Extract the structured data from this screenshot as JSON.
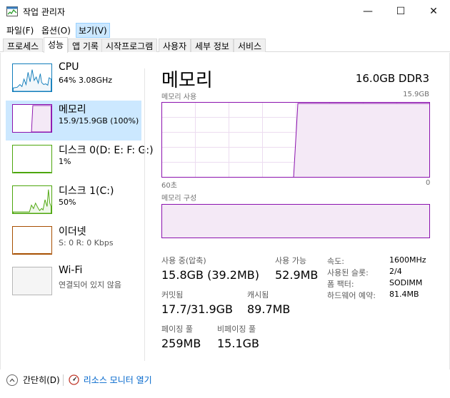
{
  "window": {
    "title": "작업 관리자",
    "buttons": {
      "minimize": "—",
      "maximize": "☐",
      "close": "✕"
    }
  },
  "menu": [
    "파일(F)",
    "옵션(O)",
    "보기(V)"
  ],
  "tabs": [
    "프로세스",
    "성능",
    "앱 기록",
    "시작프로그램",
    "사용자",
    "세부 정보",
    "서비스"
  ],
  "sidebar": {
    "items": [
      {
        "title": "CPU",
        "subtitle": "64% 3.08GHz"
      },
      {
        "title": "메모리",
        "subtitle": "15.9/15.9GB (100%)"
      },
      {
        "title": "디스크 0(D: E: F: G:)",
        "subtitle": "1%"
      },
      {
        "title": "디스크 1(C:)",
        "subtitle": "50%"
      },
      {
        "title": "이더넷",
        "subtitle": "S: 0 R: 0 Kbps"
      },
      {
        "title": "Wi-Fi",
        "subtitle": "연결되어 있지 않음"
      }
    ]
  },
  "detail": {
    "title": "메모리",
    "spec": "16.0GB DDR3",
    "graph": {
      "label": "메모리 사용",
      "max": "15.9GB",
      "time_left": "60초",
      "time_right": "0"
    },
    "composition_label": "메모리 구성",
    "stats": {
      "in_use_label": "사용 중(압축)",
      "in_use_value": "15.8GB (39.2MB)",
      "available_label": "사용 가능",
      "available_value": "52.9MB",
      "committed_label": "커밋됨",
      "committed_value": "17.7/31.9GB",
      "cached_label": "캐시됨",
      "cached_value": "89.7MB",
      "paged_label": "페이징 풀",
      "paged_value": "259MB",
      "nonpaged_label": "비페이징 풀",
      "nonpaged_value": "15.1GB"
    },
    "info": [
      {
        "label": "속도:",
        "value": "1600MHz"
      },
      {
        "label": "사용된 슬롯:",
        "value": "2/4"
      },
      {
        "label": "폼 팩터:",
        "value": "SODIMM"
      },
      {
        "label": "하드웨어 예약:",
        "value": "81.4MB"
      }
    ]
  },
  "footer": {
    "fewer_details": "간단히(D)",
    "resource_monitor": "리소스 모니터 열기"
  },
  "colors": {
    "memory": "#8b12ae",
    "cpu": "#117dbb",
    "disk": "#4da60c",
    "ethernet": "#a74f01",
    "selected": "#cce8ff"
  }
}
